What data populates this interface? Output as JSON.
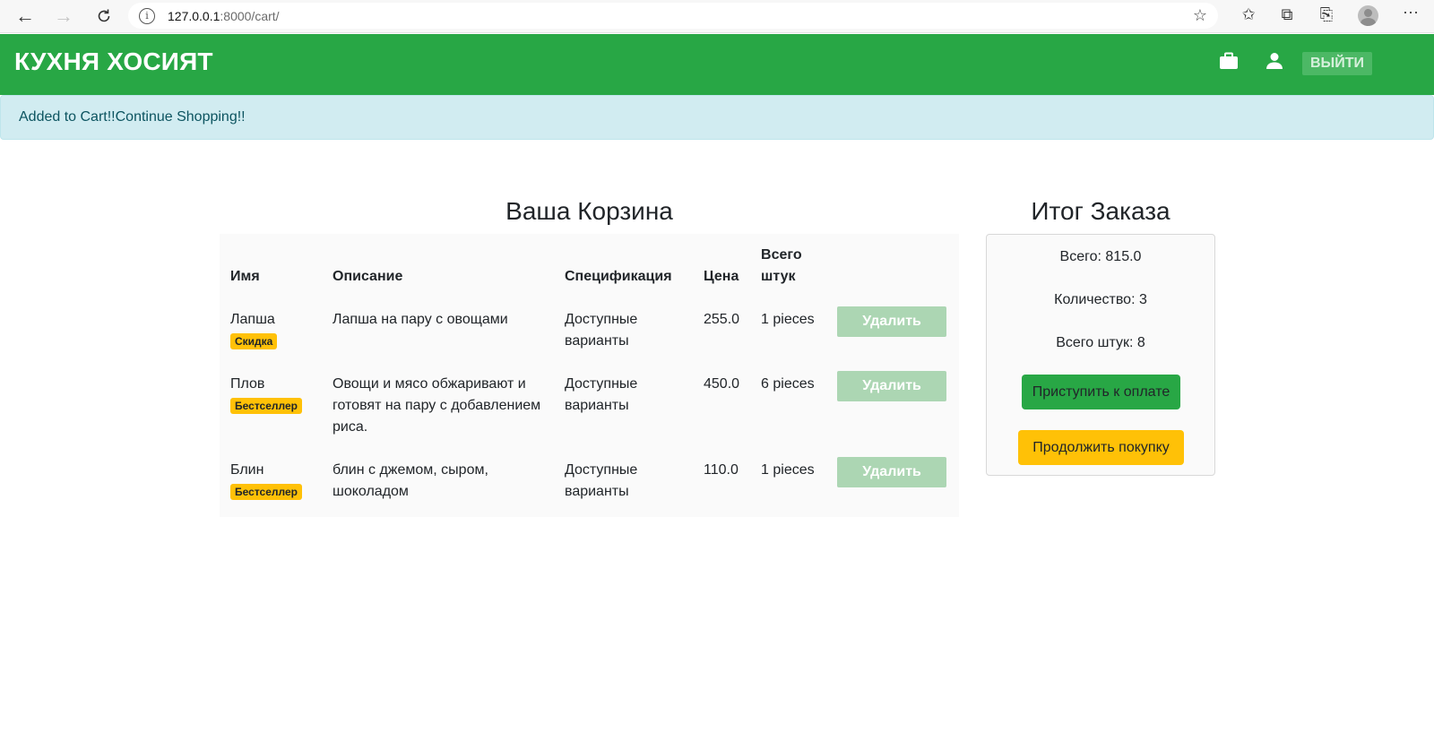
{
  "browser": {
    "url_host": "127.0.0.1",
    "url_path": ":8000/cart/"
  },
  "navbar": {
    "brand": "КУХНЯ ХОСИЯТ",
    "logout_label": "ВЫЙТИ"
  },
  "alert": {
    "message": "Added to Cart!!Continue Shopping!!"
  },
  "cart": {
    "title": "Ваша Корзина",
    "columns": [
      "Имя",
      "Описание",
      "Спецификация",
      "Цена",
      "Всего штук"
    ],
    "rows": [
      {
        "name": "Лапша",
        "badge": "Скидка",
        "description": "Лапша на пару с овощами",
        "spec": "Доступные варианты",
        "price": "255.0",
        "qty": "1 pieces",
        "delete_label": "Удалить"
      },
      {
        "name": "Плов",
        "badge": "Бестселлер",
        "description": "Овощи и мясо обжаривают и готовят на пару с добавлением риса.",
        "spec": "Доступные варианты",
        "price": "450.0",
        "qty": "6 pieces",
        "delete_label": "Удалить"
      },
      {
        "name": "Блин",
        "badge": "Бестселлер",
        "description": "блин с джемом, сыром, шоколадом",
        "spec": "Доступные варианты",
        "price": "110.0",
        "qty": "1 pieces",
        "delete_label": "Удалить"
      }
    ]
  },
  "summary": {
    "title": "Итог Заказа",
    "total": "Всего: 815.0",
    "count": "Количество: 3",
    "items": "Всего штук: 8",
    "pay_label": "Приступить к оплате",
    "continue_label": "Продолжить покупку"
  },
  "colors": {
    "navbar": "#28a745",
    "alert_bg": "#d1ecf1",
    "badge": "#ffc107",
    "delete_btn": "#acd6b3"
  }
}
